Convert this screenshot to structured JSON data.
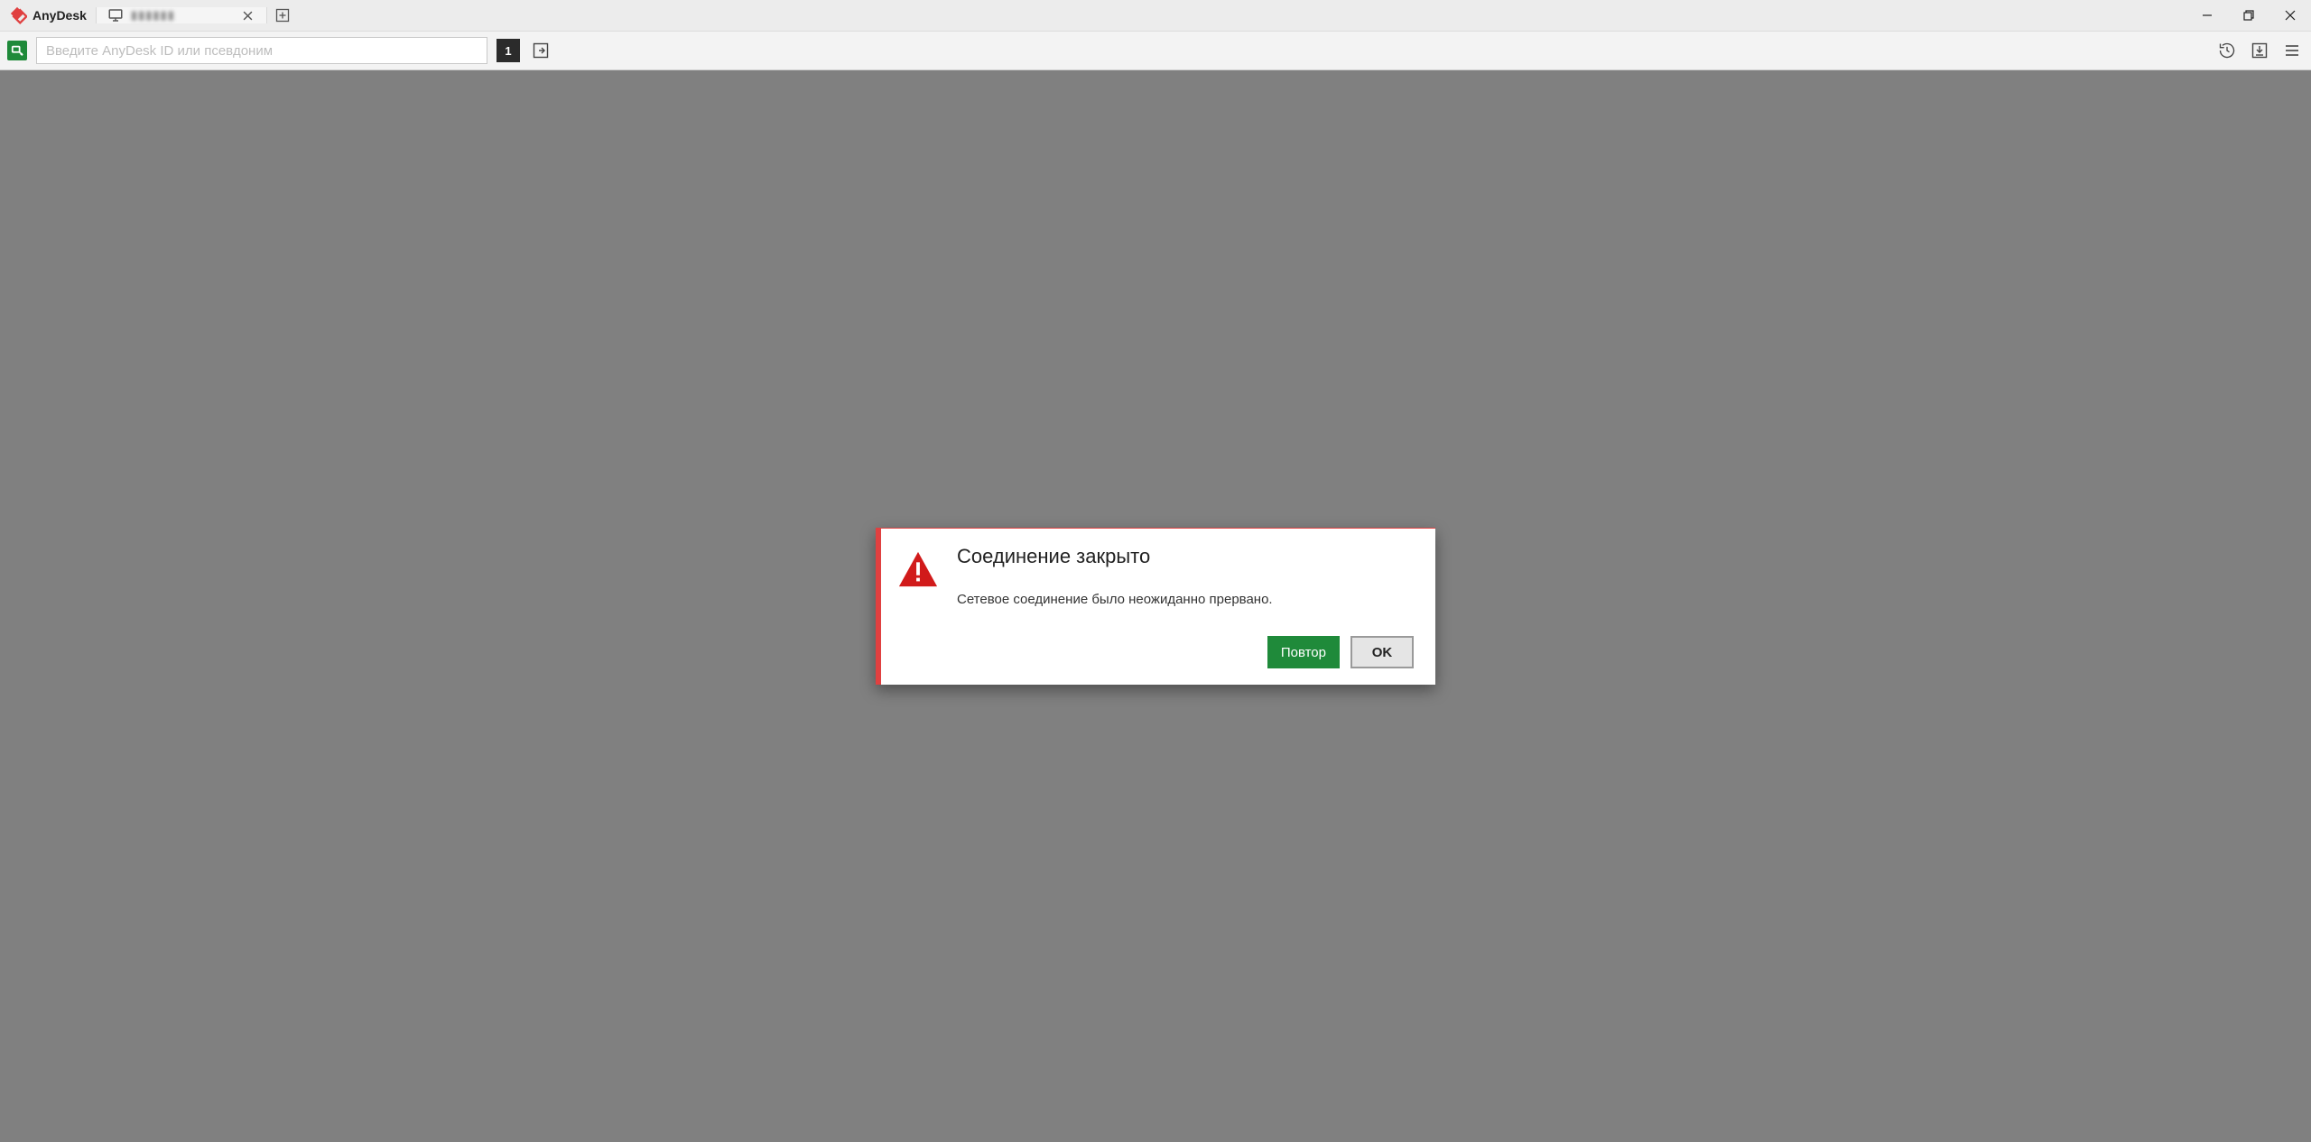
{
  "app": {
    "name": "AnyDesk"
  },
  "tabs": {
    "active": {
      "label": "▮▮▮▮▮▮"
    }
  },
  "toolbar": {
    "search_placeholder": "Введите AnyDesk ID или псевдоним",
    "badge_count": "1"
  },
  "dialog": {
    "title": "Соединение закрыто",
    "message": "Сетевое соединение было неожиданно прервано.",
    "retry_label": "Повтор",
    "ok_label": "OK"
  },
  "colors": {
    "brand_red": "#e04040",
    "ok_green": "#1f8a3a",
    "viewport_gray": "#808080"
  }
}
